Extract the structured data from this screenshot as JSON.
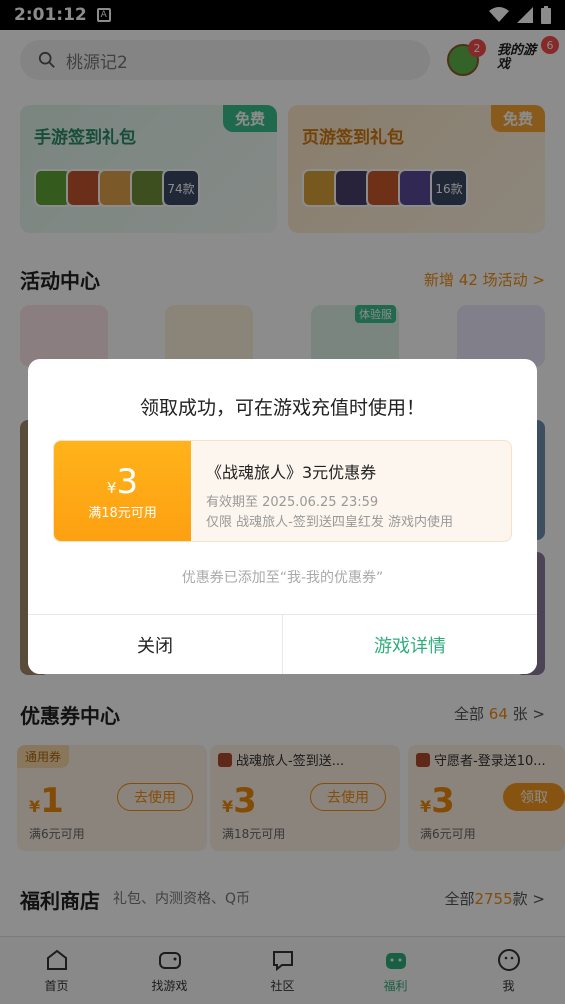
{
  "status_bar": {
    "time": "2:01:12",
    "a_label": "A"
  },
  "search": {
    "placeholder": "桃源记2"
  },
  "header": {
    "avatar_badge": "2",
    "mygame_label": "我的游戏",
    "mygame_badge": "6"
  },
  "gift_cards": [
    {
      "title": "手游签到礼包",
      "tag": "免费",
      "count": "74款"
    },
    {
      "title": "页游签到礼包",
      "tag": "免费",
      "count": "16款"
    }
  ],
  "activity": {
    "title": "活动中心",
    "more": "新增 42 场活动 >",
    "trial_tag": "体验服"
  },
  "coupon_center": {
    "title": "优惠券中心",
    "more_prefix": "全部 ",
    "more_num": "64",
    "more_suffix": " 张 >",
    "coupons": [
      {
        "tag": "通用券",
        "currency": "¥",
        "value": "1",
        "condition": "满6元可用",
        "action": "去使用"
      },
      {
        "tag": "战魂旅人-签到送...",
        "currency": "¥",
        "value": "3",
        "condition": "满18元可用",
        "action": "去使用"
      },
      {
        "tag": "守愿者-登录送10...",
        "currency": "¥",
        "value": "3",
        "condition": "满6元可用",
        "action": "领取"
      }
    ]
  },
  "shop": {
    "title": "福利商店",
    "subtitle": "礼包、内测资格、Q币",
    "more_prefix": "全部",
    "more_num": "2755",
    "more_suffix": "款 >"
  },
  "tabs": [
    "首页",
    "找游戏",
    "社区",
    "福利",
    "我"
  ],
  "modal": {
    "title": "领取成功，可在游戏充值时使用！",
    "coupon": {
      "currency": "¥",
      "value": "3",
      "condition": "满18元可用",
      "name": "《战魂旅人》3元优惠券",
      "validity": "有效期至 2025.06.25 23:59",
      "scope": "仅限 战魂旅人-签到送四皇红发 游戏内使用"
    },
    "hint": "优惠券已添加至“我-我的优惠券”",
    "close_label": "关闭",
    "detail_label": "游戏详情"
  },
  "colors": {
    "accent_green": "#2fae7b",
    "accent_orange": "#f08c12",
    "coupon_orange": "#ffb31a"
  }
}
